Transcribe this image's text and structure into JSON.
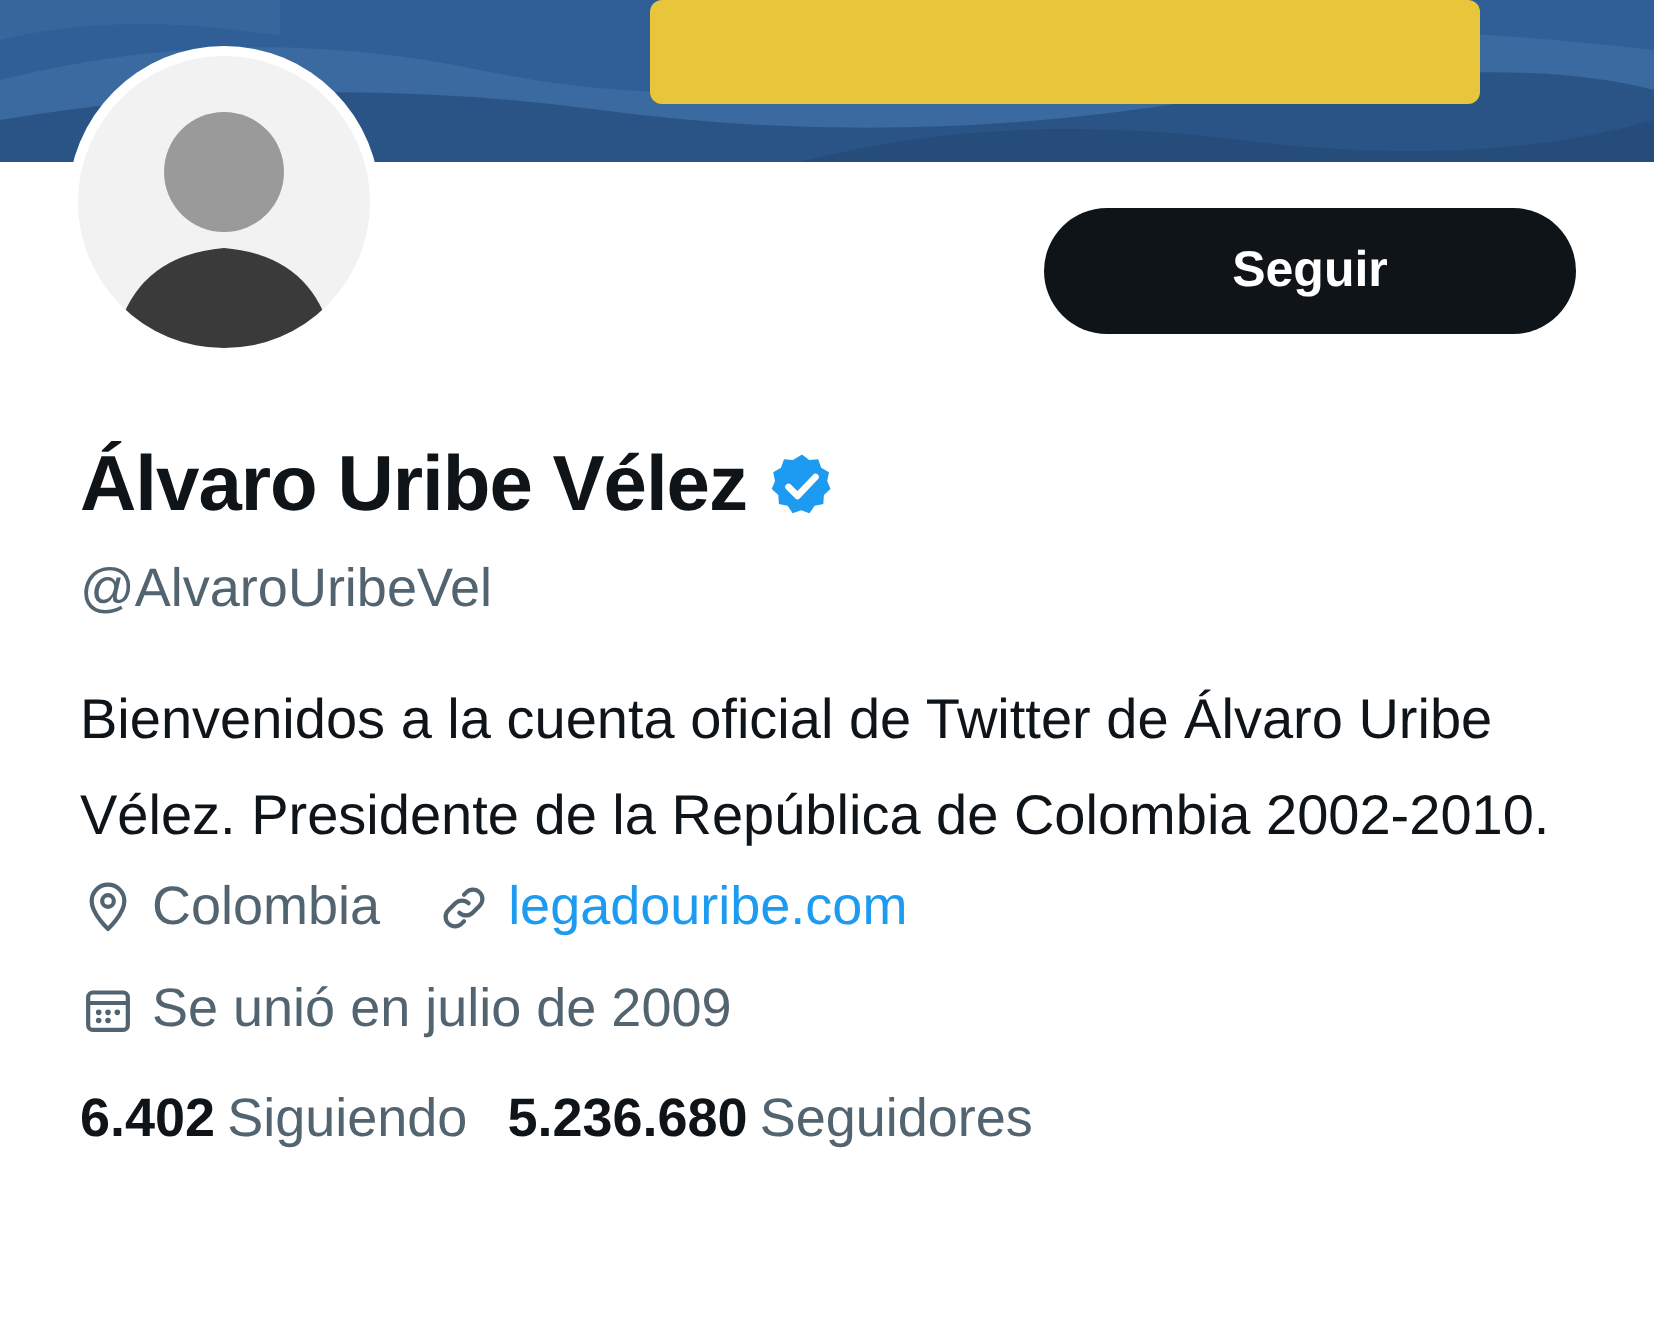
{
  "follow_button": {
    "label": "Seguir"
  },
  "profile": {
    "name": "Álvaro Uribe Vélez",
    "verified": true,
    "handle": "@AlvaroUribeVel",
    "bio": "Bienvenidos a la cuenta oficial de Twitter de Álvaro Uribe Vélez. Presidente de la República de Colombia 2002-2010.",
    "location": "Colombia",
    "website": "legadouribe.com",
    "joined": "Se unió en julio de 2009"
  },
  "stats": [
    {
      "count": "6.402",
      "label": "Siguiendo"
    },
    {
      "count": "5.236.680",
      "label": "Seguidores"
    }
  ]
}
